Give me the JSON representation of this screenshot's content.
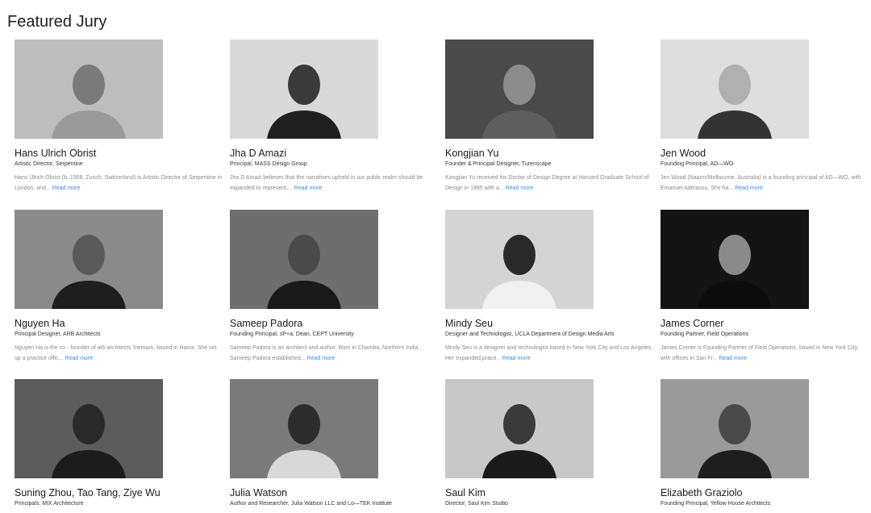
{
  "section": {
    "title": "Featured Jury"
  },
  "read_more_label": "Read more",
  "link_color": "#3a8ee6",
  "jurors": [
    {
      "name": "Hans Ulrich Obrist",
      "role": "Artistic Director, Serpentine",
      "bio": "Hans Ulrich Obrist (b. 1968, Zurich, Switzerland) is Artistic Director of Serpentine in London, and...",
      "photo": {
        "bg": "#bdbdbd",
        "fg": "#7a7a7a",
        "shirt": "#9a9a9a"
      }
    },
    {
      "name": "Jha D Amazi",
      "role": "Principal, MASS Design Group",
      "bio": "Jha D Amazi believes that the narratives upheld in our public realm should be expanded to represent,...",
      "photo": {
        "bg": "#d9d9d9",
        "fg": "#3a3a3a",
        "shirt": "#202020"
      }
    },
    {
      "name": "Kongjian Yu",
      "role": "Founder & Principal Designer, Turenscape",
      "bio": "Kongjian Yu received his Doctor of Design Degree at Harvard Graduate School of Design in 1995 with a...",
      "photo": {
        "bg": "#4a4a4a",
        "fg": "#8c8c8c",
        "shirt": "#5e5e5e"
      }
    },
    {
      "name": "Jen Wood",
      "role": "Founding Principal, AD—WO",
      "bio": "Jen Wood (Naarm/Melbourne, Australia) is a founding principal of AD—WO, with Emanuel Admassu. She ha...",
      "photo": {
        "bg": "#dedede",
        "fg": "#b0b0b0",
        "shirt": "#333333"
      }
    },
    {
      "name": "Nguyen Ha",
      "role": "Principal Designer, ARB Architects",
      "bio": "Nguyen Ha is the co - founder of arb architects Vietnam, based in Hanoi. She set up a practice offic...",
      "photo": {
        "bg": "#8a8a8a",
        "fg": "#5a5a5a",
        "shirt": "#1e1e1e"
      }
    },
    {
      "name": "Sameep Padora",
      "role": "Founding Principal, sP+a; Dean, CEPT University",
      "bio": "Sameep Padora is an architect and author. Born in Chamba, Northern India, Sameep Padora established...",
      "photo": {
        "bg": "#6e6e6e",
        "fg": "#4a4a4a",
        "shirt": "#1a1a1a"
      }
    },
    {
      "name": "Mindy Seu",
      "role": "Designer and Technologist, UCLA Department of Design Media Arts",
      "bio": "Mindy Seu is a designer and technologist based in New York City and Los Angeles. Her expanded practi...",
      "photo": {
        "bg": "#d4d4d4",
        "fg": "#2a2a2a",
        "shirt": "#f0f0f0"
      }
    },
    {
      "name": "James Corner",
      "role": "Founding Partner, Field Operations",
      "bio": "James Corner is Founding Partner of Field Operations, based in New York City, with offices in San Fr...",
      "photo": {
        "bg": "#141414",
        "fg": "#8a8a8a",
        "shirt": "#0c0c0c"
      }
    },
    {
      "name": "Suning Zhou, Tao Tang, Ziye Wu",
      "role": "Principals, MIX Architecture",
      "bio": "",
      "photo": {
        "bg": "#5c5c5c",
        "fg": "#2a2a2a",
        "shirt": "#1c1c1c"
      }
    },
    {
      "name": "Julia Watson",
      "role": "Author and Researcher, Julia Watson LLC and Lo—TEK Institute",
      "bio": "",
      "photo": {
        "bg": "#7a7a7a",
        "fg": "#2c2c2c",
        "shirt": "#d8d8d8"
      }
    },
    {
      "name": "Saul Kim",
      "role": "Director, Saul Kim Studio",
      "bio": "",
      "photo": {
        "bg": "#c8c8c8",
        "fg": "#3a3a3a",
        "shirt": "#1a1a1a"
      }
    },
    {
      "name": "Elizabeth Graziolo",
      "role": "Founding Principal, Yellow House Architects",
      "bio": "",
      "photo": {
        "bg": "#9a9a9a",
        "fg": "#4a4a4a",
        "shirt": "#1e1e1e"
      }
    }
  ]
}
